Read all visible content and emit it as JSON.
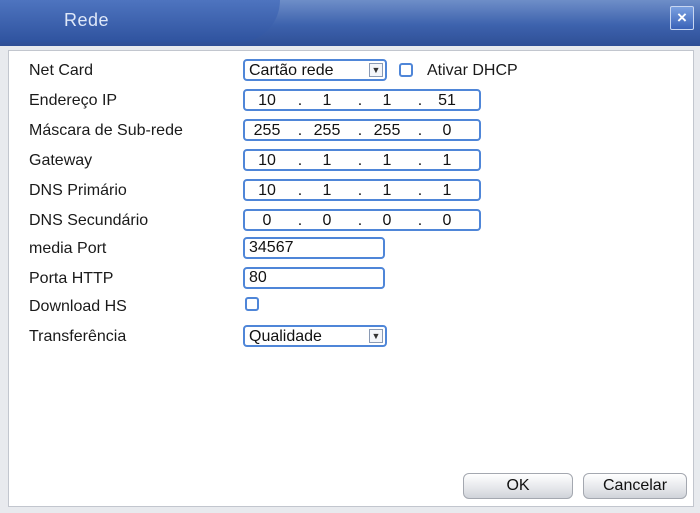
{
  "dialog": {
    "title": "Rede",
    "close_glyph": "×"
  },
  "net_card": {
    "label": "Net Card",
    "value": "Cartão rede",
    "dhcp_label": "Ativar DHCP",
    "dhcp_checked": false
  },
  "ip_address": {
    "label": "Endereço IP",
    "octets": [
      "10",
      "1",
      "1",
      "51"
    ]
  },
  "subnet_mask": {
    "label": "Máscara de Sub-rede",
    "octets": [
      "255",
      "255",
      "255",
      "0"
    ]
  },
  "gateway": {
    "label": "Gateway",
    "octets": [
      "10",
      "1",
      "1",
      "1"
    ]
  },
  "dns_primary": {
    "label": "DNS Primário",
    "octets": [
      "10",
      "1",
      "1",
      "1"
    ]
  },
  "dns_secondary": {
    "label": "DNS Secundário",
    "octets": [
      "0",
      "0",
      "0",
      "0"
    ]
  },
  "media_port": {
    "label": "media Port",
    "value": "34567"
  },
  "http_port": {
    "label": "Porta HTTP",
    "value": "80"
  },
  "download_hs": {
    "label": "Download HS",
    "checked": false
  },
  "transfer": {
    "label": "Transferência",
    "value": "Qualidade"
  },
  "buttons": {
    "ok": "OK",
    "cancel": "Cancelar"
  },
  "dropdown_arrow_glyph": "▼",
  "ip_dot_glyph": "."
}
